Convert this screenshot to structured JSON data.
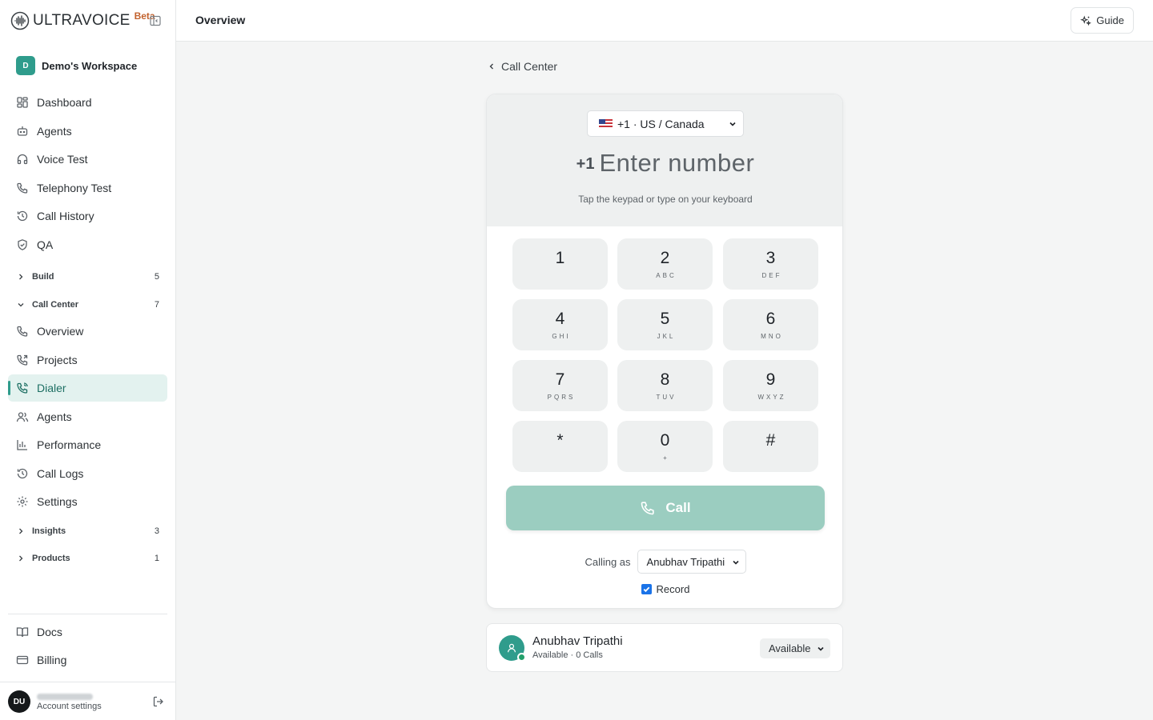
{
  "brand": {
    "name": "ULTRAVOICE",
    "badge": "Beta"
  },
  "workspace": {
    "initial": "D",
    "name": "Demo's Workspace"
  },
  "nav": {
    "dashboard": "Dashboard",
    "agents": "Agents",
    "voice_test": "Voice Test",
    "telephony_test": "Telephony Test",
    "call_history": "Call History",
    "qa": "QA"
  },
  "sections": {
    "build": {
      "label": "Build",
      "count": "5"
    },
    "call_center": {
      "label": "Call Center",
      "count": "7"
    },
    "insights": {
      "label": "Insights",
      "count": "3"
    },
    "products": {
      "label": "Products",
      "count": "1"
    }
  },
  "call_center_items": {
    "overview": "Overview",
    "projects": "Projects",
    "dialer": "Dialer",
    "agents": "Agents",
    "performance": "Performance",
    "call_logs": "Call Logs",
    "settings": "Settings"
  },
  "footer_nav": {
    "docs": "Docs",
    "billing": "Billing"
  },
  "account": {
    "initials": "DU",
    "settings_label": "Account settings"
  },
  "header": {
    "title": "Overview",
    "guide_label": "Guide"
  },
  "main": {
    "back_label": "Call Center",
    "country": "+1 · US / Canada",
    "prefix": "+1",
    "number_placeholder": "Enter number",
    "hint": "Tap the keypad or type on your keyboard",
    "keypad": [
      {
        "digit": "1",
        "letters": ""
      },
      {
        "digit": "2",
        "letters": "ABC"
      },
      {
        "digit": "3",
        "letters": "DEF"
      },
      {
        "digit": "4",
        "letters": "GHI"
      },
      {
        "digit": "5",
        "letters": "JKL"
      },
      {
        "digit": "6",
        "letters": "MNO"
      },
      {
        "digit": "7",
        "letters": "PQRS"
      },
      {
        "digit": "8",
        "letters": "TUV"
      },
      {
        "digit": "9",
        "letters": "WXYZ"
      },
      {
        "digit": "*",
        "letters": ""
      },
      {
        "digit": "0",
        "letters": "+"
      },
      {
        "digit": "#",
        "letters": ""
      }
    ],
    "call_label": "Call",
    "calling_as_label": "Calling as",
    "calling_as_value": "Anubhav Tripathi",
    "record_label": "Record",
    "record_checked": true
  },
  "agent_card": {
    "name": "Anubhav Tripathi",
    "status_line": "Available · 0 Calls",
    "status_value": "Available"
  },
  "colors": {
    "accent": "#2f9c8c",
    "active_bg": "#e3f2ef",
    "call_button": "#9bcdc0",
    "beta": "#c2622e",
    "online": "#22a06b"
  }
}
